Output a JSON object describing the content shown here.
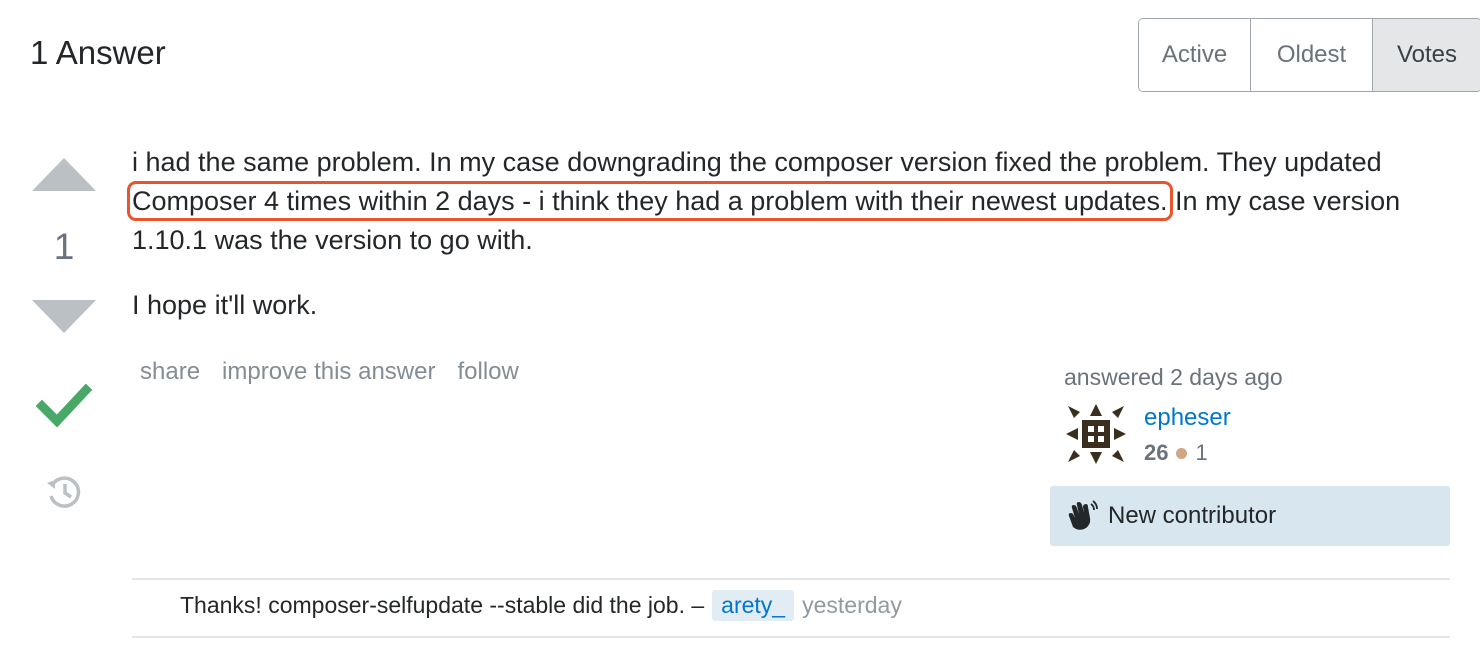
{
  "header": {
    "title": "1 Answer"
  },
  "sort": {
    "options": [
      {
        "label": "Active"
      },
      {
        "label": "Oldest"
      },
      {
        "label": "Votes"
      }
    ],
    "selected": "Votes"
  },
  "vote": {
    "count": "1",
    "accepted": true
  },
  "answer": {
    "paragraph1_before": "i had the same problem. In my case downgrading the composer version fixed the problem. They updated ",
    "paragraph1_highlight": "Composer 4 times within 2 days - i think they had a problem with their newest updates.",
    "paragraph1_after": " In my case version 1.10.1 was the version to go with.",
    "paragraph2": "I hope it'll work."
  },
  "post_menu": {
    "share": "share",
    "improve": "improve this answer",
    "follow": "follow"
  },
  "user": {
    "action_time": "answered 2 days ago",
    "name": "epheser",
    "reputation": "26",
    "bronze_badges": "1"
  },
  "new_contributor": {
    "label": "New contributor"
  },
  "comment": {
    "text": "Thanks! composer-selfupdate --stable did the job. –",
    "user": "arety_",
    "date": "yesterday"
  },
  "colors": {
    "highlight": "#e8542c",
    "link": "#0077cc",
    "accepted": "#48a868",
    "new_contributor_bg": "#d7e6ef"
  }
}
